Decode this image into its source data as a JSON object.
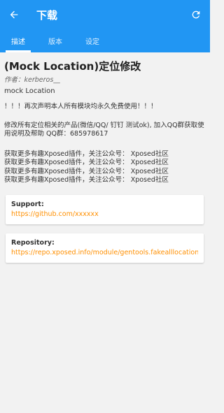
{
  "app": {
    "title": "下载",
    "colors": {
      "primary": "#2196f3",
      "link": "#ff8f00",
      "background": "#f2f2f2"
    },
    "icons": {
      "back": "arrow-left-icon",
      "refresh": "refresh-icon"
    }
  },
  "tabs": [
    {
      "label": "描述",
      "selected": true
    },
    {
      "label": "版本",
      "selected": false
    },
    {
      "label": "设定",
      "selected": false
    }
  ],
  "module": {
    "title": "(Mock Location)定位修改",
    "author_prefix": "作者：",
    "author": "kerberos__",
    "package": "mock Location"
  },
  "description": {
    "line1": "！！！再次声明本人所有模块均永久免费使用！！！",
    "line2": "修改所有定位相关的产品(微信/QQ/ 钉钉 测试ok), 加入QQ群获取使用说明及帮助 QQ群：685978617",
    "promo": [
      "获取更多有趣Xposed插件，关注公众号： Xposed社区",
      "获取更多有趣Xposed插件，关注公众号： Xposed社区",
      "获取更多有趣Xposed插件，关注公众号： Xposed社区",
      "获取更多有趣Xposed插件，关注公众号： Xposed社区"
    ]
  },
  "support": {
    "label": "Support:",
    "link": "https://github.com/xxxxxx"
  },
  "repository": {
    "label": "Repository:",
    "link": "https://repo.xposed.info/module/gentools.fakealllocation"
  }
}
